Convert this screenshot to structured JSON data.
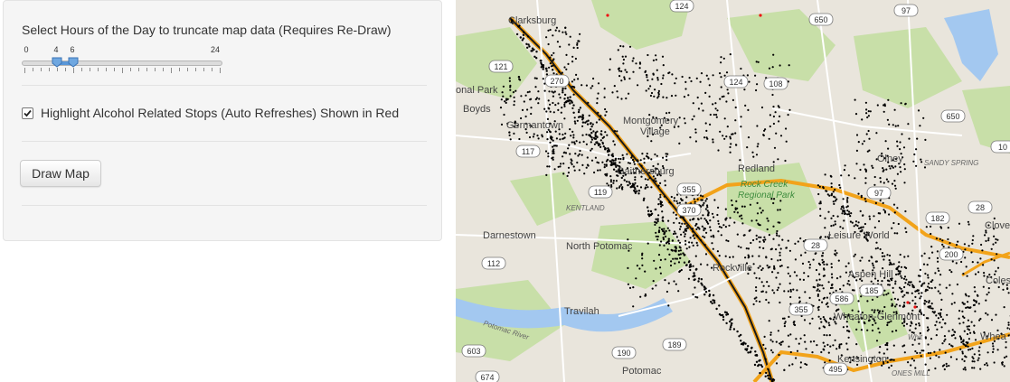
{
  "panel": {
    "slider_title": "Select Hours of the Day to truncate map data (Requires Re-Draw)",
    "slider": {
      "min": 0,
      "max": 24,
      "low": 4,
      "high": 6,
      "min_label": "0",
      "max_label": "24",
      "low_label": "4",
      "high_label": "6"
    },
    "checkbox_label": "Highlight Alcohol Related Stops (Auto Refreshes) Shown in Red",
    "checkbox_checked": true,
    "draw_button": "Draw Map"
  },
  "map": {
    "places": [
      "Clarksburg",
      "onal Park",
      "Boyds",
      "Germantown",
      "Montgomery",
      "Village",
      "Gaithersburg",
      "Redland",
      "Rock Creek",
      "Regional Park",
      "KENTLAND",
      "Darnestown",
      "North Potomac",
      "Rockville",
      "Leisure World",
      "Aspen Hill",
      "Olney",
      "SANDY SPRING",
      "Wheaton-Glenmont",
      "Kensington",
      "Travilah",
      "Potomac",
      "Potomac River",
      "Clove",
      "Colesv",
      "Whea",
      "Whit",
      "ONES MILL"
    ],
    "shields": [
      "124",
      "650",
      "97",
      "121",
      "124",
      "108",
      "650",
      "10",
      "270",
      "117",
      "119",
      "355",
      "370",
      "28",
      "97",
      "182",
      "200",
      "28",
      "185",
      "586",
      "355",
      "112",
      "190",
      "189",
      "603",
      "674",
      "495"
    ]
  }
}
